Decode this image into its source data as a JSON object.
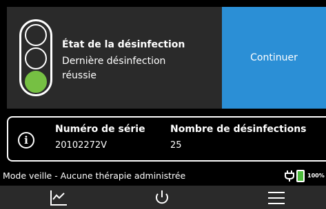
{
  "disinfection": {
    "title": "État de la désinfection",
    "line1": "Dernière désinfection",
    "line2": "réussie",
    "status_color": "#76c043"
  },
  "actions": {
    "continue_label": "Continuer",
    "continue_color": "#2b8fd6"
  },
  "device": {
    "serial_label": "Numéro de série",
    "serial_value": "20102272V",
    "count_label": "Nombre de désinfections",
    "count_value": "25",
    "info_icon": "i"
  },
  "status_bar": {
    "mode_text": "Mode veille - Aucune thérapie administrée",
    "battery_percent_label": "100%",
    "battery_level": 1.0,
    "battery_color": "#4cbb3c",
    "icons": [
      "plug-icon",
      "battery-icon"
    ]
  },
  "nav": {
    "icons": [
      "graph-icon",
      "power-icon",
      "menu-icon"
    ]
  }
}
